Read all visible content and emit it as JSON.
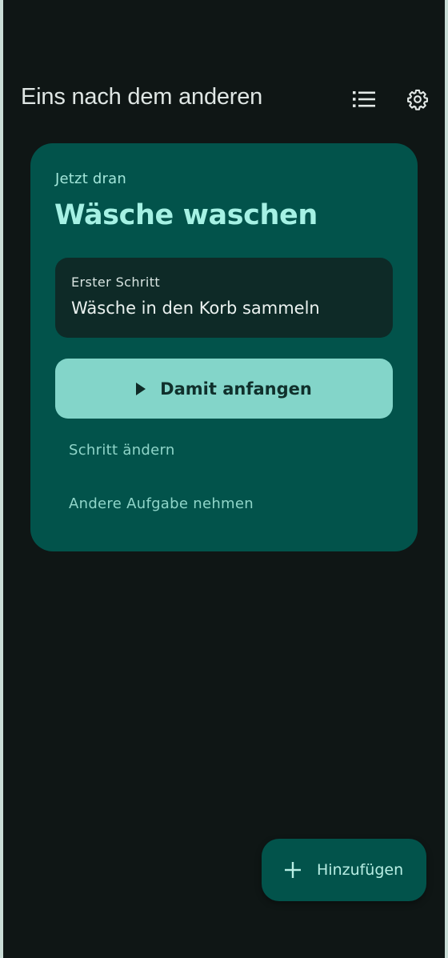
{
  "header": {
    "title": "Eins nach dem anderen",
    "list_icon": "list-icon",
    "settings_icon": "gear-icon"
  },
  "current_task": {
    "eyebrow": "Jetzt dran",
    "title": "Wäsche waschen",
    "first_step_label": "Erster Schritt",
    "first_step_text": "Wäsche in den Korb sammeln",
    "start_button_label": "Damit anfangen",
    "start_button_icon": "play-icon",
    "change_step_label": "Schritt ändern",
    "other_task_label": "Andere Aufgabe nehmen"
  },
  "fab": {
    "label": "Hinzufügen",
    "icon": "plus-icon"
  },
  "colors": {
    "background": "#0f1615",
    "card": "#02534b",
    "accent_text": "#a5f1e4",
    "primary_button": "#83d5c9",
    "step_box": "#0e2a27"
  }
}
